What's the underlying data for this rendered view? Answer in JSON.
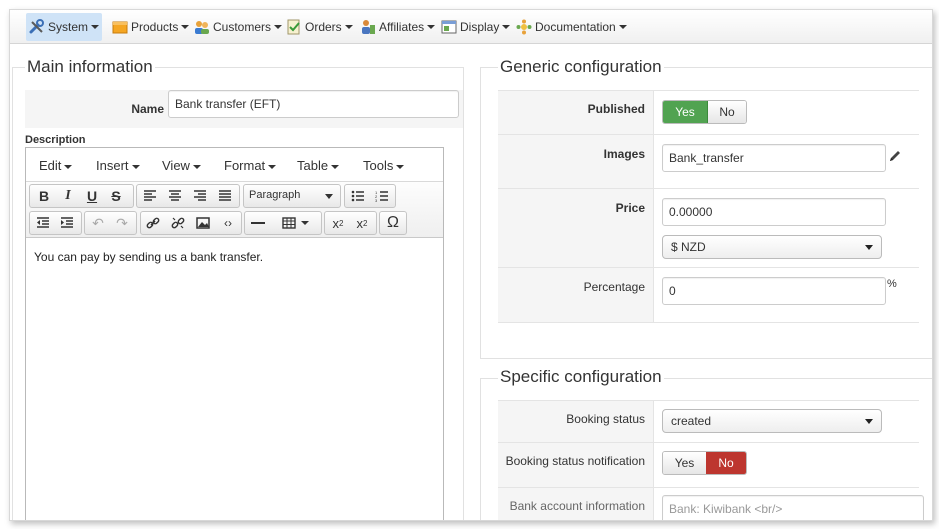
{
  "nav": {
    "items": [
      {
        "label": "System",
        "icon": "wrench-icon",
        "active": true
      },
      {
        "label": "Products",
        "icon": "box-icon"
      },
      {
        "label": "Customers",
        "icon": "users-icon"
      },
      {
        "label": "Orders",
        "icon": "orders-icon"
      },
      {
        "label": "Affiliates",
        "icon": "affiliates-icon"
      },
      {
        "label": "Display",
        "icon": "display-icon"
      },
      {
        "label": "Documentation",
        "icon": "documentation-icon"
      }
    ]
  },
  "main": {
    "legend": "Main information",
    "name_label": "Name",
    "name_value": "Bank transfer (EFT)",
    "description_label": "Description",
    "editor": {
      "menus": [
        "Edit",
        "Insert",
        "View",
        "Format",
        "Table",
        "Tools"
      ],
      "format_select": "Paragraph",
      "content": "You can pay by sending us a bank transfer."
    }
  },
  "generic": {
    "legend": "Generic configuration",
    "published_label": "Published",
    "published_yes": "Yes",
    "published_no": "No",
    "images_label": "Images",
    "images_value": "Bank_transfer",
    "price_label": "Price",
    "price_value": "0.00000",
    "currency_value": "$ NZD",
    "percentage_label": "Percentage",
    "percentage_value": "0",
    "percentage_unit": "%"
  },
  "specific": {
    "legend": "Specific configuration",
    "booking_status_label": "Booking status",
    "booking_status_value": "created",
    "notification_label": "Booking status notification",
    "notification_yes": "Yes",
    "notification_no": "No",
    "bank_account_label": "Bank account information",
    "bank_account_placeholder": "Bank: Kiwibank <br/>"
  },
  "colors": {
    "accent_green": "#51a351",
    "accent_red": "#bd362f",
    "nav_active": "#cfe3f7"
  }
}
